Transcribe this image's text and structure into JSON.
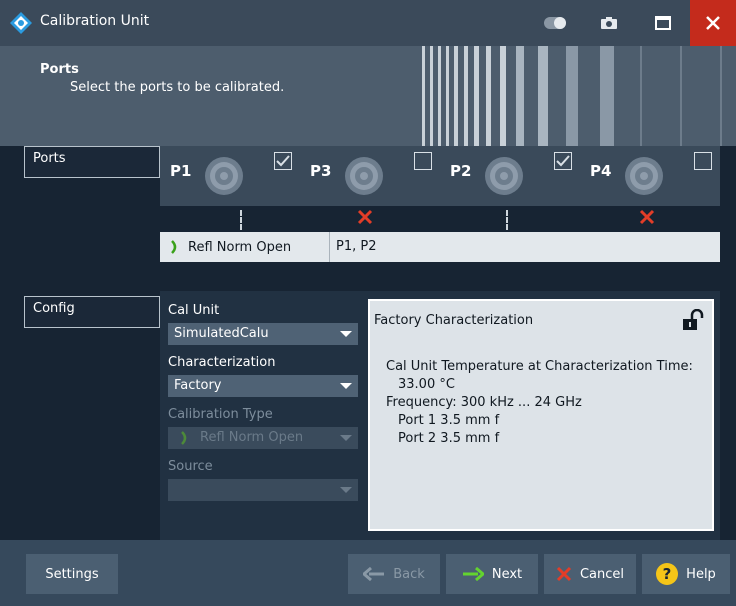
{
  "window": {
    "title": "Calibration Unit",
    "colors": {
      "titlebar": "#3b4a5a",
      "close": "#c42b1c",
      "accent_green": "#63d32f",
      "error_red": "#e23d28",
      "help_yellow": "#f5c518"
    }
  },
  "header": {
    "title": "Ports",
    "description": "Select the ports to be calibrated."
  },
  "sidebar": {
    "items": [
      {
        "label": "Ports"
      },
      {
        "label": "Config"
      }
    ]
  },
  "ports": [
    {
      "label": "P1",
      "checked": true,
      "connected": true
    },
    {
      "label": "P3",
      "checked": false,
      "connected": false
    },
    {
      "label": "P2",
      "checked": true,
      "connected": true
    },
    {
      "label": "P4",
      "checked": false,
      "connected": false
    }
  ],
  "method_row": {
    "name": "Refl Norm Open",
    "ports": "P1, P2"
  },
  "config": {
    "cal_unit_label": "Cal Unit",
    "cal_unit_value": "SimulatedCalu",
    "characterization_label": "Characterization",
    "characterization_value": "Factory",
    "calibration_type_label": "Calibration Type",
    "calibration_type_value": "Refl Norm Open",
    "source_label": "Source",
    "source_value": ""
  },
  "info": {
    "title": "Factory Characterization",
    "line1": "Cal Unit Temperature at Characterization Time:",
    "line2": "33.00 °C",
    "line3": "Frequency: 300 kHz ... 24 GHz",
    "line4": "Port 1 3.5 mm f",
    "line5": "Port 2 3.5 mm f"
  },
  "footer": {
    "settings": "Settings",
    "back": "Back",
    "next": "Next",
    "cancel": "Cancel",
    "help": "Help"
  }
}
